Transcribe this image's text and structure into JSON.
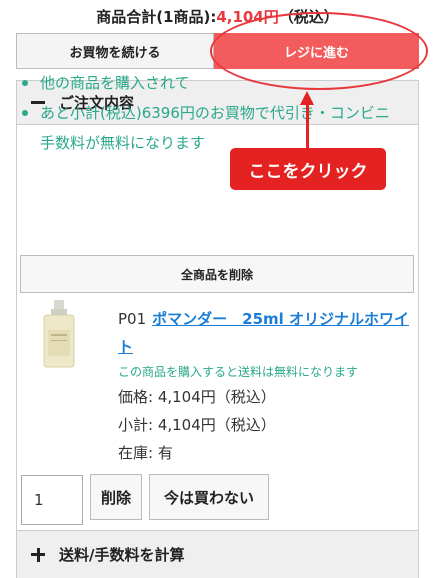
{
  "cart_summary": {
    "label": "商品合計(1商品):",
    "amount": "4,104円",
    "tax": "（税込）"
  },
  "buttons": {
    "continue_shopping": "お買物を続ける",
    "go_to_register": "レジに進む",
    "delete_all": "全商品を削除",
    "remove": "削除",
    "save_for_later": "今は買わない"
  },
  "order_panel": {
    "title": "ご注文内容",
    "notes": [
      "他の商品を購入されて",
      "あと小計(税込)6396円のお買物で代引き・コンビニ手数料が無料になります"
    ]
  },
  "annotation": {
    "callout": "ここをクリック",
    "color": "#e42222"
  },
  "product": {
    "code": "P01",
    "name": "ポマンダー　25ml オリジナルホワイト",
    "promo": "この商品を購入すると送料は無料になります",
    "price": "価格: 4,104円（税込）",
    "subtotal": "小計: 4,104円（税込）",
    "stock": "在庫: 有",
    "quantity": "1"
  },
  "shipping": {
    "label": "送料/手数料を計算"
  },
  "colors": {
    "accent_red": "#e8383d",
    "register_button": "#f25c5c",
    "note_green": "#2aa88a",
    "link_blue": "#1a7ed6"
  }
}
